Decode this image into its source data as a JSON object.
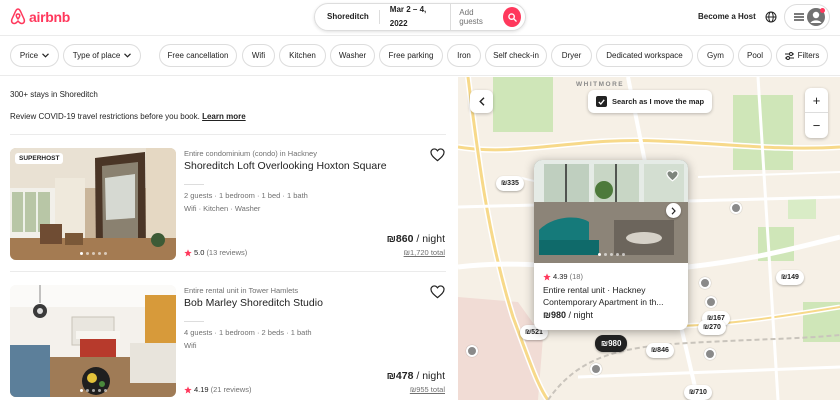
{
  "header": {
    "logo_text": "airbnb",
    "search": {
      "location": "Shoreditch",
      "dates": "Mar 2 – 4, 2022",
      "guests_placeholder": "Add guests"
    },
    "become_host": "Become a Host",
    "brand_color": "#ff385c"
  },
  "filters": [
    {
      "label": "Price",
      "dropdown": true
    },
    {
      "label": "Type of place",
      "dropdown": true
    },
    {
      "label": "Free cancellation"
    },
    {
      "label": "Wifi"
    },
    {
      "label": "Kitchen"
    },
    {
      "label": "Washer"
    },
    {
      "label": "Free parking"
    },
    {
      "label": "Iron"
    },
    {
      "label": "Self check-in"
    },
    {
      "label": "Dryer"
    },
    {
      "label": "Dedicated workspace"
    },
    {
      "label": "Gym"
    },
    {
      "label": "Pool"
    },
    {
      "label": "Filters",
      "icon": "sliders-icon"
    }
  ],
  "results": {
    "count_text": "300+ stays in Shoreditch",
    "covid_text": "Review COVID-19 travel restrictions before you book.",
    "learn_more": "Learn more"
  },
  "listings": [
    {
      "badge": "SUPERHOST",
      "subtitle": "Entire condominium (condo) in Hackney",
      "title": "Shoreditch Loft Overlooking Hoxton Square",
      "details": "2 guests · 1 bedroom · 1 bed · 1 bath",
      "amenities": "Wifi · Kitchen · Washer",
      "rating": "5.0",
      "reviews": "(13 reviews)",
      "price": "₪860",
      "per": " / night",
      "total": "₪1,720 total"
    },
    {
      "badge": "",
      "subtitle": "Entire rental unit in Tower Hamlets",
      "title": "Bob Marley Shoreditch Studio",
      "details": "4 guests · 1 bedroom · 2 beds · 1 bath",
      "amenities": "Wifi",
      "rating": "4.19",
      "reviews": "(21 reviews)",
      "price": "₪478",
      "per": " / night",
      "total": "₪955 total"
    }
  ],
  "map": {
    "area_label": "WHITMORE",
    "search_as_move": "Search as I move the map",
    "zoom_in": "+",
    "zoom_out": "−",
    "pins": [
      "₪335",
      "₪149",
      "₪167",
      "₪270",
      "₪521",
      "₪980",
      "₪846",
      "₪710"
    ],
    "card": {
      "rating": "4.39",
      "reviews": "(18)",
      "title": "Entire rental unit · Hackney Contemporary Apartment in th...",
      "price": "₪980",
      "per": " / night"
    }
  }
}
